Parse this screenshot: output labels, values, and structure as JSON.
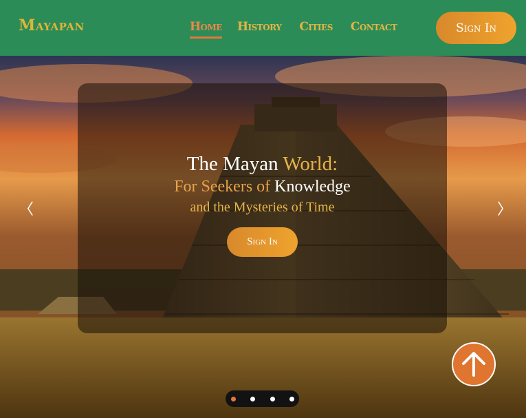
{
  "header": {
    "logo": "Mayapan",
    "nav": [
      "Home",
      "History",
      "Cities",
      "Contact"
    ],
    "active_nav": "Home",
    "signin_label": "Sign In"
  },
  "hero": {
    "line1_a": "The Mayan ",
    "line1_b": "World:",
    "line2_a": "For Seekers of ",
    "line2_b": "Knowledge",
    "line3": "and the Mysteries of Time",
    "signin_label": "Sign In",
    "prev_arrow": "〈",
    "next_arrow": "〉",
    "slide_count": 4,
    "active_slide": 1,
    "background": "pyramid-at-sunset-image"
  },
  "icons": {
    "prev": "chevron-left-icon",
    "next": "chevron-right-icon",
    "scroll_top": "arrow-up-icon"
  },
  "colors": {
    "header_bg": "#2b8c57",
    "gold": "#e4b545",
    "accent": "#e8773a",
    "button_gradient_start": "#d8892b",
    "button_gradient_end": "#efa32d"
  }
}
